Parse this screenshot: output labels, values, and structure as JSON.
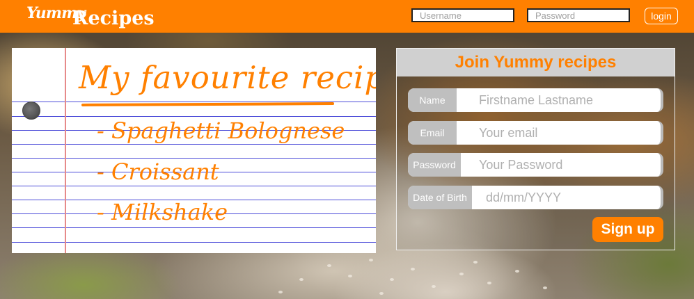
{
  "colors": {
    "accent": "#ff8000",
    "header_bg": "#ff8000",
    "field_label_bg": "#bfbfbf",
    "notebook_rule": "#4a4ad8",
    "notebook_margin": "#e68a8a"
  },
  "header": {
    "brand_part1": "Yummy",
    "brand_part2": "Recipes",
    "username_placeholder": "Username",
    "password_placeholder": "Password",
    "login_label": "login"
  },
  "notebook": {
    "title": "My favourite recipes",
    "items": [
      "- Spaghetti Bolognese",
      "- Croissant",
      "- Milkshake"
    ]
  },
  "signup": {
    "title": "Join Yummy recipes",
    "fields": [
      {
        "label": "Name",
        "placeholder": "Firstname Lastname"
      },
      {
        "label": "Email",
        "placeholder": "Your email"
      },
      {
        "label": "Password",
        "placeholder": "Your Password"
      },
      {
        "label": "Date of Birth",
        "placeholder": "dd/mm/YYYY"
      }
    ],
    "submit_label": "Sign up"
  }
}
